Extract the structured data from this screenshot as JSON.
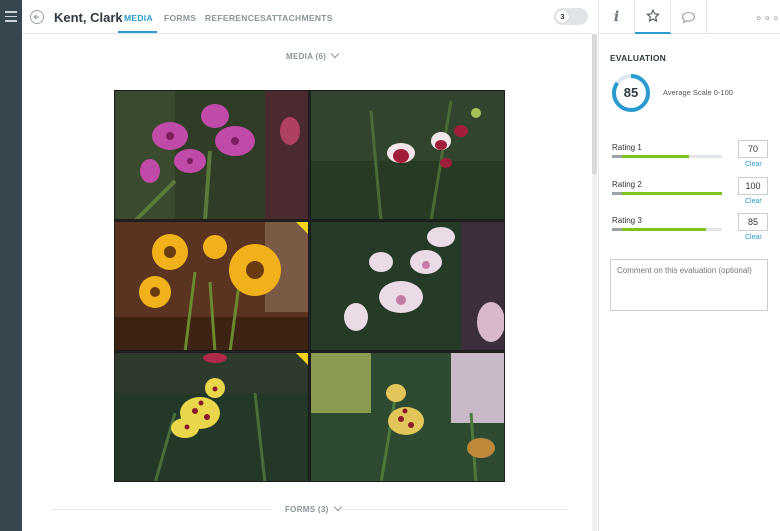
{
  "header": {
    "name": "Kent, Clark",
    "tabs": [
      {
        "label": "MEDIA",
        "active": true
      },
      {
        "label": "FORMS",
        "active": false
      },
      {
        "label": "REFERENCES",
        "active": false
      },
      {
        "label": "ATTACHMENTS",
        "active": false
      }
    ],
    "toggle_value": "3"
  },
  "media_section": {
    "label": "MEDIA (6)"
  },
  "forms_section": {
    "label": "FORMS (3)"
  },
  "media": [
    {
      "subject": "pink spotted orchids",
      "flagged": false
    },
    {
      "subject": "red and white orchid sprays",
      "flagged": false
    },
    {
      "subject": "sunflowers in a vase",
      "flagged": true
    },
    {
      "subject": "white and pink orchids",
      "flagged": false
    },
    {
      "subject": "yellow orchid with red spots",
      "flagged": true
    },
    {
      "subject": "yellow spotted orchid",
      "flagged": false
    }
  ],
  "right_panel": {
    "icons": [
      "info-icon",
      "star-icon",
      "comment-icon",
      "more-icon"
    ],
    "evaluation_title": "EVALUATION",
    "score": "85",
    "score_fraction": 0.85,
    "scale_text": "Average Scale 0-100",
    "ratings": [
      {
        "label": "Rating 1",
        "value": "70",
        "fraction": 0.7,
        "clear": "Clear"
      },
      {
        "label": "Rating 2",
        "value": "100",
        "fraction": 1.0,
        "clear": "Clear"
      },
      {
        "label": "Rating 3",
        "value": "85",
        "fraction": 0.85,
        "clear": "Clear"
      }
    ],
    "comment_placeholder": "Comment on this evaluation (optional)"
  },
  "colors": {
    "accent": "#2a9bd1",
    "rating_fill": "#7fc31c",
    "flag": "#f2d21b",
    "sidebar": "#37474f"
  }
}
